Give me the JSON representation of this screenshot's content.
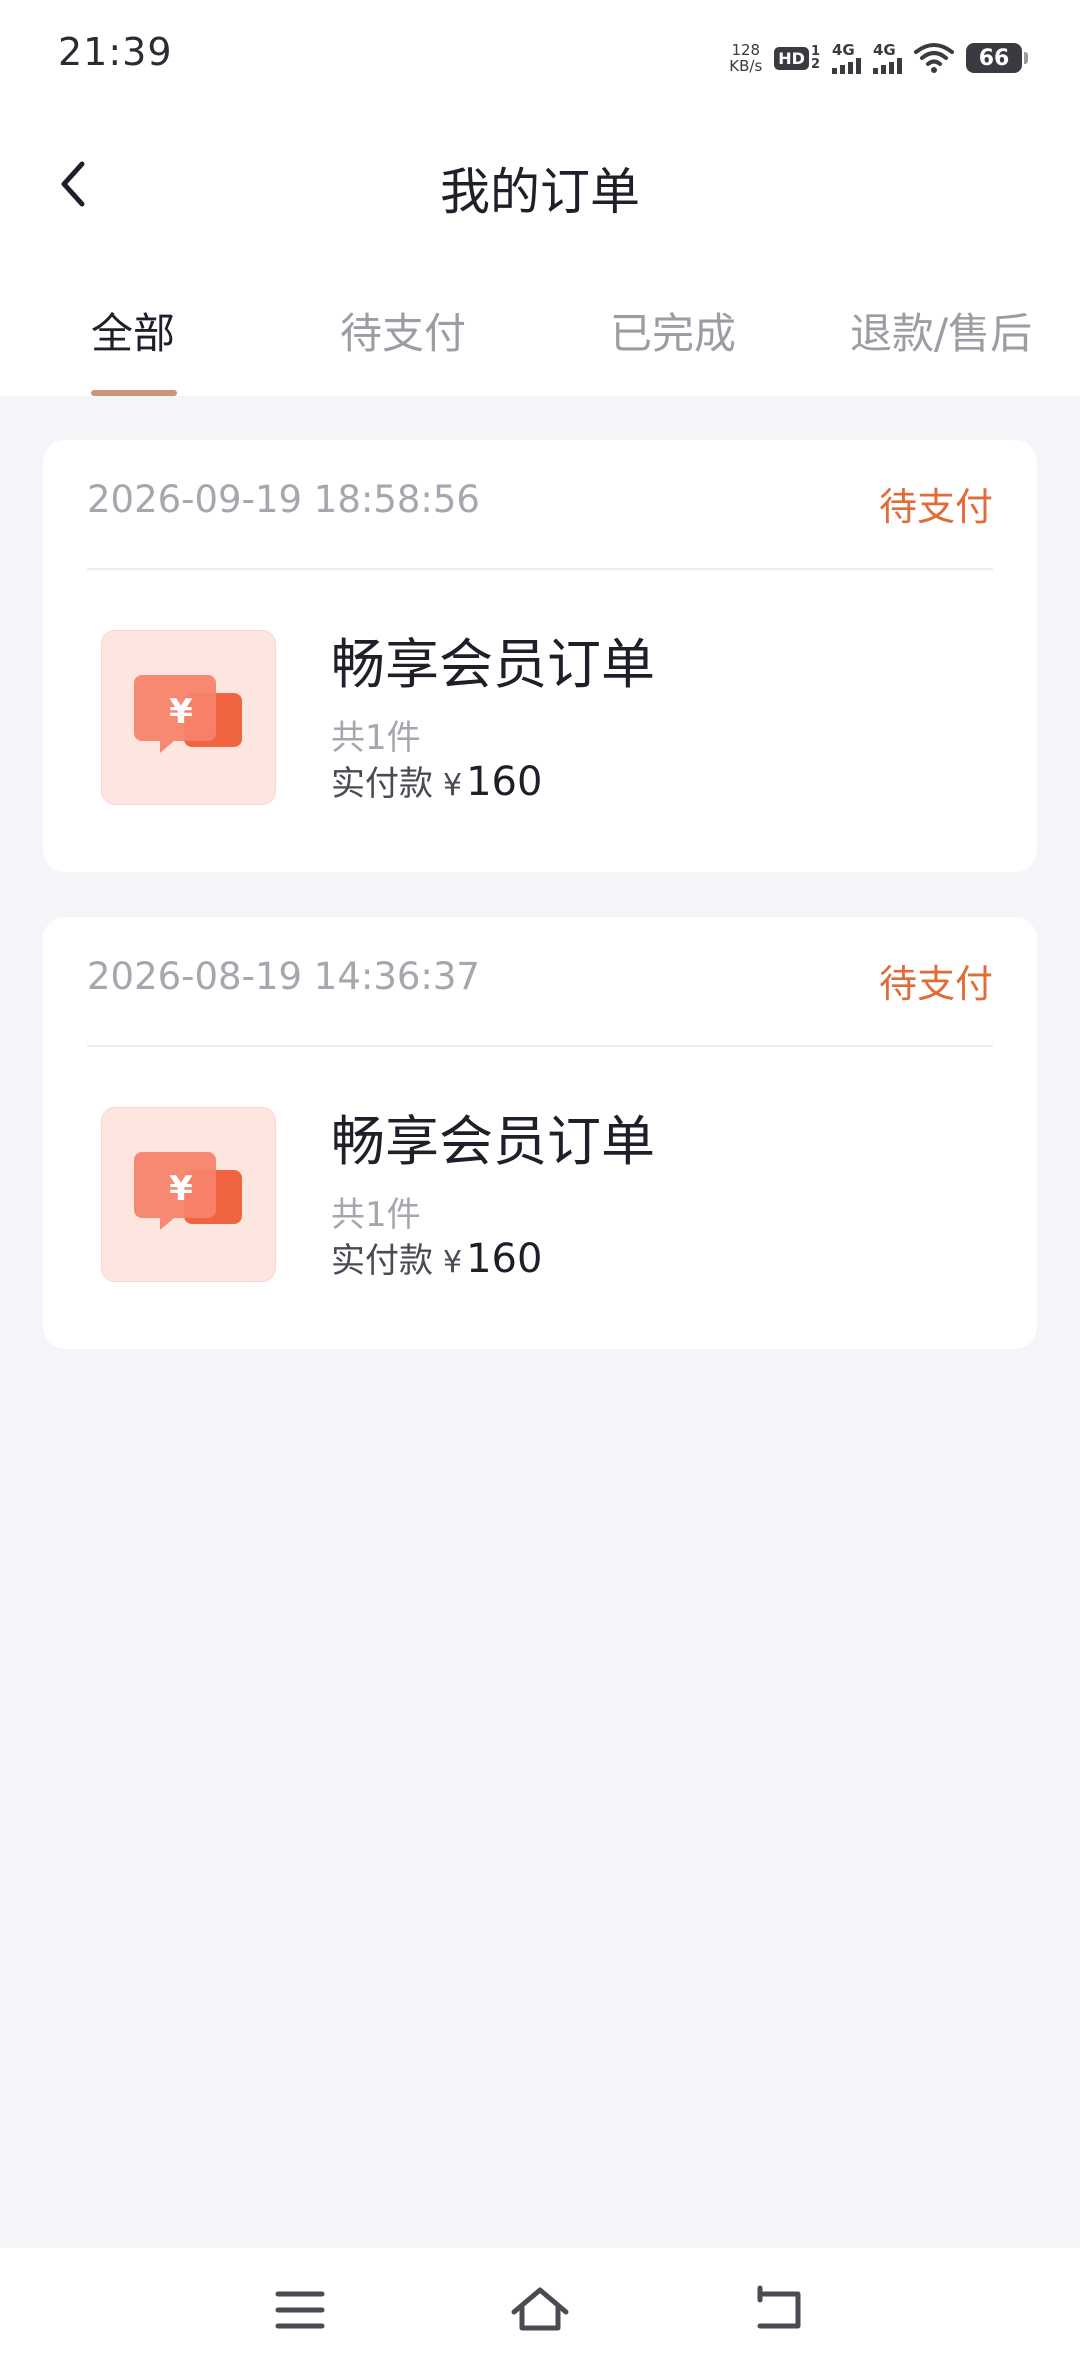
{
  "status_bar": {
    "time": "21:39",
    "net_speed_value": "128",
    "net_speed_unit": "KB/s",
    "hd_label": "HD",
    "hd_sub_top": "1",
    "hd_sub_bottom": "2",
    "sim1_label": "4G",
    "sim2_label": "4G",
    "battery": "66"
  },
  "header": {
    "title": "我的订单",
    "back_icon": "chevron-left-icon"
  },
  "tabs": [
    {
      "label": "全部",
      "active": true
    },
    {
      "label": "待支付",
      "active": false
    },
    {
      "label": "已完成",
      "active": false
    },
    {
      "label": "退款/售后",
      "active": false
    }
  ],
  "orders": [
    {
      "datetime": "2026-09-19 18:58:56",
      "status": "待支付",
      "name": "畅享会员订单",
      "count": "共1件",
      "paid_label": "实付款",
      "currency": "¥",
      "amount": "160",
      "icon": "yuan-chat-icon"
    },
    {
      "datetime": "2026-08-19 14:36:37",
      "status": "待支付",
      "name": "畅享会员订单",
      "count": "共1件",
      "paid_label": "实付款",
      "currency": "¥",
      "amount": "160",
      "icon": "yuan-chat-icon"
    }
  ],
  "system_nav": {
    "menu_icon": "menu-icon",
    "home_icon": "home-icon",
    "back_icon": "back-icon"
  },
  "colors": {
    "accent": "#e06c3a",
    "tab_indicator": "#c8967a",
    "background": "#f4f5f9"
  }
}
